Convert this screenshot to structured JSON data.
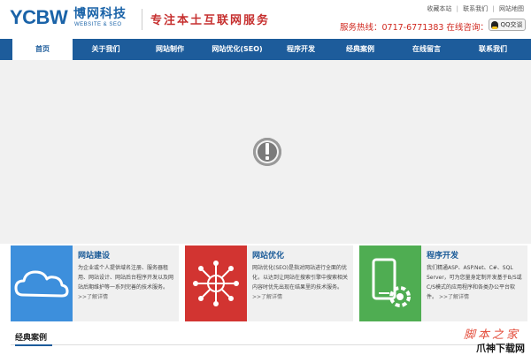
{
  "header": {
    "logo_mark": "YCBW",
    "logo_cn": "博网科技",
    "logo_en": "WEBSITE & SEO",
    "slogan": "专注本土互联网服务",
    "top_links": [
      "收藏本站",
      "联系我们",
      "网站地图"
    ],
    "hotline": "服务热线：0717-6771383 在线咨询：",
    "qq_label": "QQ交谈"
  },
  "nav": {
    "items": [
      {
        "label": "首页",
        "active": true
      },
      {
        "label": "关于我们",
        "active": false
      },
      {
        "label": "网站制作",
        "active": false
      },
      {
        "label": "网站优化(SEO)",
        "active": false
      },
      {
        "label": "程序开发",
        "active": false
      },
      {
        "label": "经典案例",
        "active": false
      },
      {
        "label": "在线留言",
        "active": false
      },
      {
        "label": "联系我们",
        "active": false
      }
    ]
  },
  "stage": {
    "loader_icon": "alert-loading-icon"
  },
  "cards": [
    {
      "title": "网站建设",
      "desc": "为企业或个人提供域名注册、服务器租用、网站设计、网站后台程序开发以及网站后期维护等一系列完善的技术服务。",
      "more": ">>了解详情",
      "icon": "cloud-icon",
      "color": "#3d8fdc"
    },
    {
      "title": "网站优化",
      "desc": "网站优化(SEO)是指对网站进行全面的优化，以达到让网站在搜索引擎中搜索相关内容时优先出现在结果里的技术服务。",
      "more": ">>了解详情",
      "icon": "network-globe-icon",
      "color": "#d23431"
    },
    {
      "title": "程序开发",
      "desc": "我们精通ASP、ASP.Net、C#、SQL Server，可为您量身定制开发基于B/S或C/S模式的应用程序和各类办公平台软件。",
      "more": ">>了解详情",
      "icon": "mobile-gear-icon",
      "color": "#4fad52"
    }
  ],
  "section": {
    "title": "经典案例"
  },
  "watermark": {
    "line1": "脚本之家",
    "line2": "爪神下载网"
  }
}
